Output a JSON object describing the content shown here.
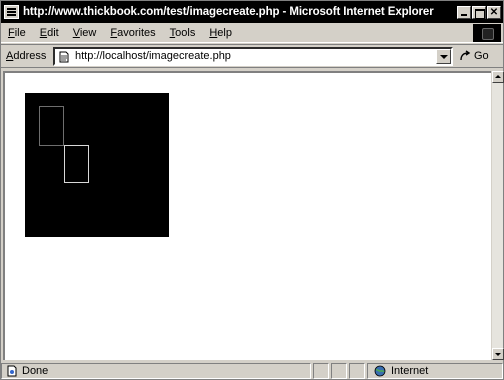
{
  "window": {
    "title": "http://www.thickbook.com/test/imagecreate.php - Microsoft Internet Explorer"
  },
  "menu": {
    "items": [
      {
        "first": "F",
        "rest": "ile"
      },
      {
        "first": "E",
        "rest": "dit"
      },
      {
        "first": "V",
        "rest": "iew"
      },
      {
        "first": "F",
        "rest": "avorites"
      },
      {
        "first": "T",
        "rest": "ools"
      },
      {
        "first": "H",
        "rest": "elp"
      }
    ]
  },
  "address": {
    "label_first": "A",
    "label_rest": "ddress",
    "url": "http://localhost/imagecreate.php",
    "go_label": "Go"
  },
  "status": {
    "text": "Done",
    "zone": "Internet"
  },
  "colors": {
    "canvas_background": "#000000",
    "rect1_stroke": "#6e6e6e",
    "rect2_stroke": "#d8d8d8"
  }
}
